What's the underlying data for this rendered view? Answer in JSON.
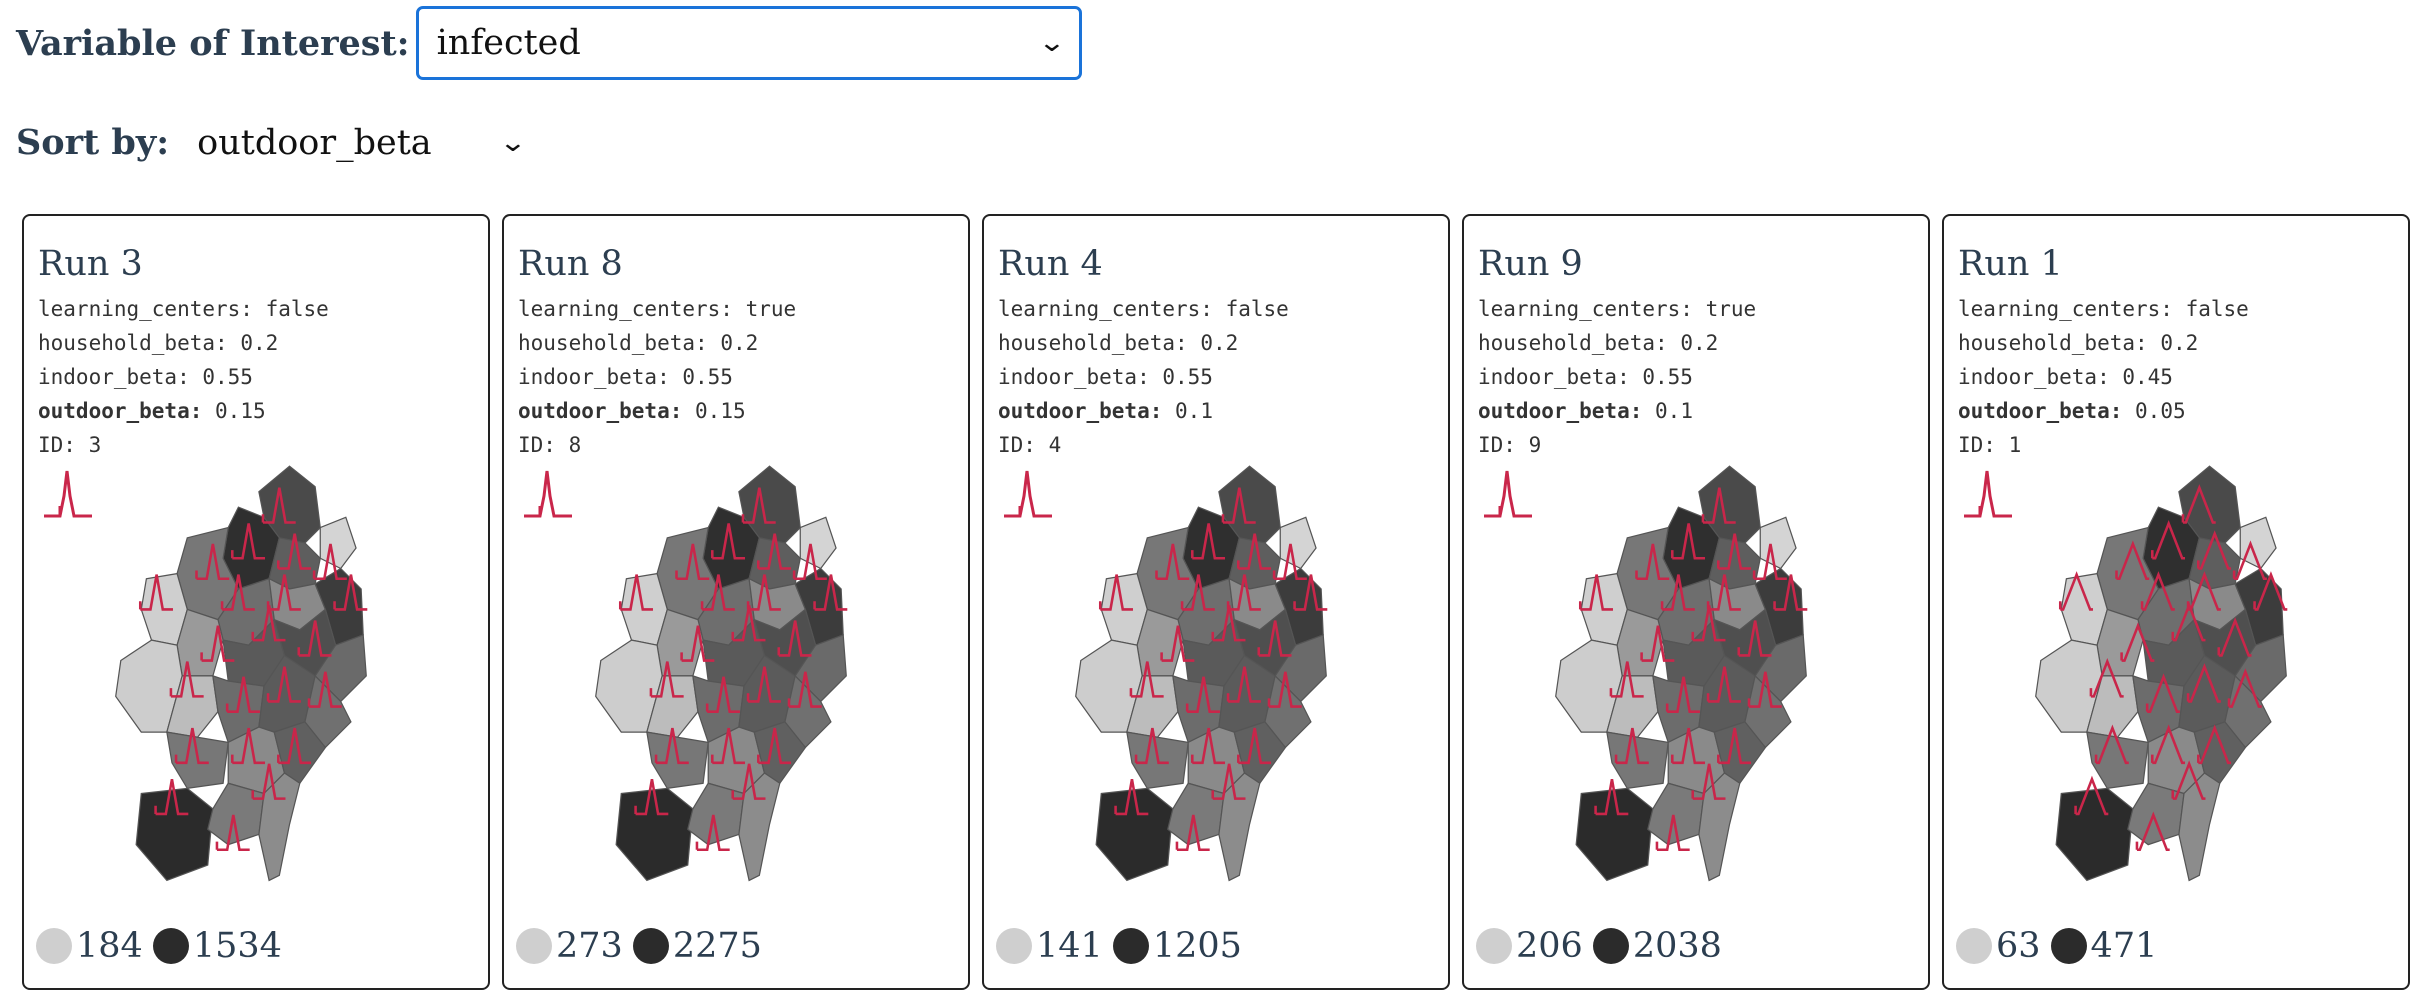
{
  "controls": {
    "variable_label": "Variable of Interest:",
    "variable_value": "infected",
    "sort_label": "Sort by:",
    "sort_value": "outdoor_beta"
  },
  "colors": {
    "accent": "#c9264a",
    "select_border": "#1a73d9",
    "light_region": "#cfcfcf",
    "dark_region": "#2b2b2b"
  },
  "runs": [
    {
      "title": "Run 3",
      "learning_centers": "false",
      "household_beta": "0.2",
      "indoor_beta": "0.55",
      "outdoor_beta": "0.15",
      "id": "3",
      "min": "184",
      "max": "1534"
    },
    {
      "title": "Run 8",
      "learning_centers": "true",
      "household_beta": "0.2",
      "indoor_beta": "0.55",
      "outdoor_beta": "0.15",
      "id": "8",
      "min": "273",
      "max": "2275"
    },
    {
      "title": "Run 4",
      "learning_centers": "false",
      "household_beta": "0.2",
      "indoor_beta": "0.55",
      "outdoor_beta": "0.1",
      "id": "4",
      "min": "141",
      "max": "1205"
    },
    {
      "title": "Run 9",
      "learning_centers": "true",
      "household_beta": "0.2",
      "indoor_beta": "0.55",
      "outdoor_beta": "0.1",
      "id": "9",
      "min": "206",
      "max": "2038"
    },
    {
      "title": "Run 1",
      "learning_centers": "false",
      "household_beta": "0.2",
      "indoor_beta": "0.45",
      "outdoor_beta": "0.05",
      "id": "1",
      "min": "63",
      "max": "471"
    }
  ],
  "param_keys": {
    "learning_centers": "learning_centers:",
    "household_beta": "household_beta:",
    "indoor_beta": "indoor_beta:",
    "outdoor_beta": "outdoor_beta:",
    "id": "ID:"
  }
}
